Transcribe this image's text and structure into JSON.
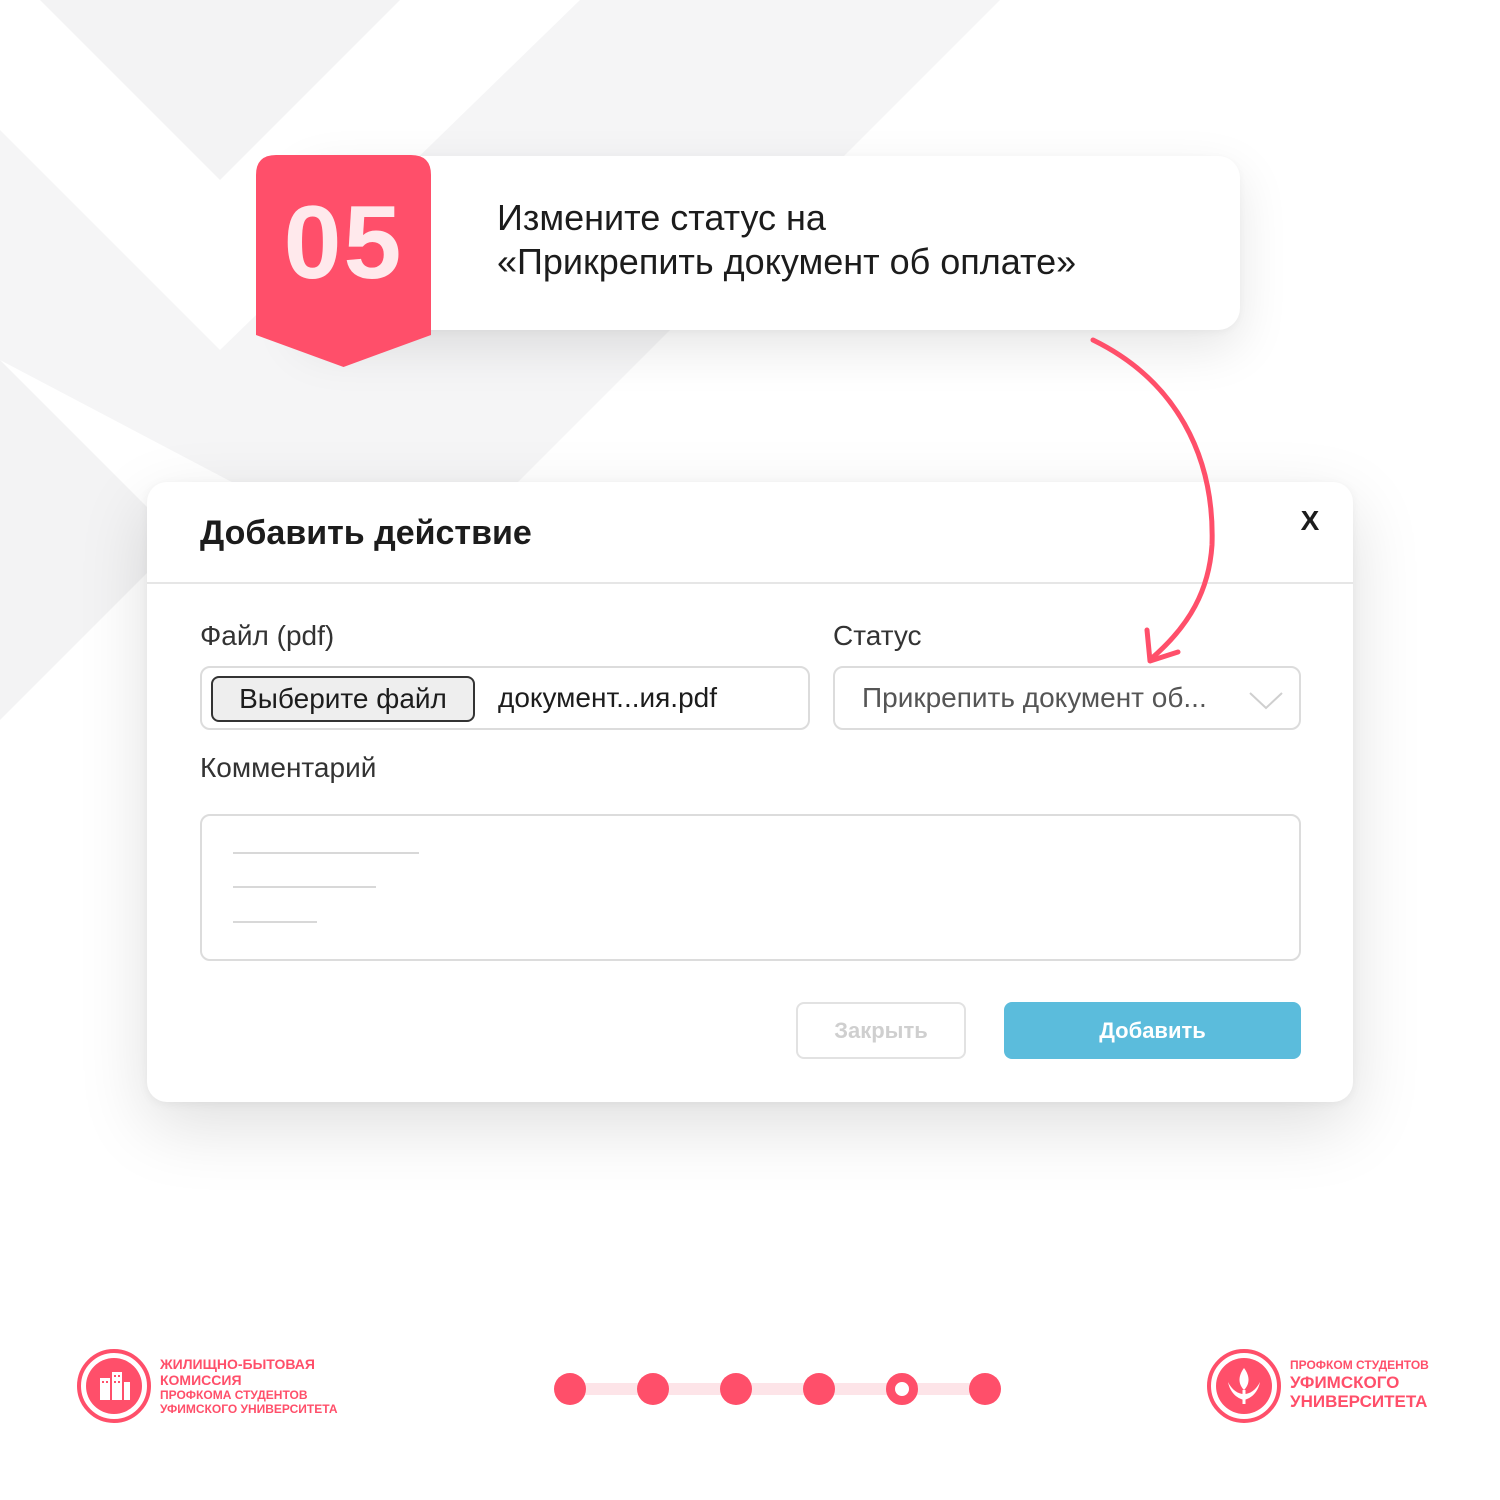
{
  "step": {
    "number": "05",
    "line1": "Измените статус на",
    "line2": "«Прикрепить документ об оплате»"
  },
  "dialog": {
    "title": "Добавить действие",
    "close_icon": "X",
    "file_label": "Файл (pdf)",
    "choose_file_label": "Выберите файл",
    "file_name": "документ...ия.pdf",
    "status_label": "Статус",
    "status_value": "Прикрепить документ об...",
    "comment_label": "Комментарий",
    "close_button": "Закрыть",
    "add_button": "Добавить"
  },
  "footer": {
    "left_org": {
      "line1": "ЖИЛИЩНО-БЫТОВАЯ",
      "line2": "КОМИССИЯ",
      "line3": "ПРОФКОМА СТУДЕНТОВ",
      "line4": "УФИМСКОГО УНИВЕРСИТЕТА"
    },
    "right_org": {
      "line1": "ПРОФКОМ СТУДЕНТОВ",
      "line2": "УФИМСКОГО",
      "line3": "УНИВЕРСИТЕТА"
    },
    "progress": {
      "total": 6,
      "current": 5
    }
  },
  "colors": {
    "accent": "#ff4f6a",
    "primary_button": "#5bbcdc",
    "background_chevron": "#f4f4f5"
  }
}
